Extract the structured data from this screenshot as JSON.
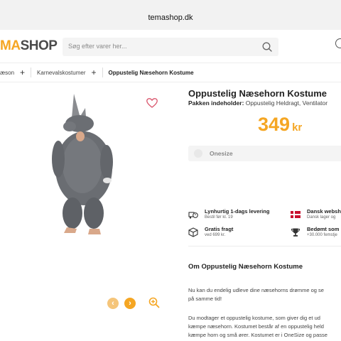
{
  "browser": {
    "url": "temashop.dk"
  },
  "header": {
    "logo_part1": "MA",
    "logo_part2": "SHOP",
    "search_placeholder": "Søg efter varer her...",
    "brand_color": "#f5a623"
  },
  "breadcrumb": [
    {
      "label": "æson"
    },
    {
      "label": "Karnevalskostumer"
    },
    {
      "label": "Oppustelig Næsehorn Kostume"
    }
  ],
  "gallery": {
    "prev_icon": "chevron-left-icon",
    "next_icon": "chevron-right-icon",
    "zoom_icon": "zoom-in-icon"
  },
  "product": {
    "title": "Oppustelig Næsehorn Kostume",
    "contents_label": "Pakken indeholder:",
    "contents_value": "Oppustelig Heldragt, Ventilator",
    "price": "349",
    "currency": "kr",
    "size_option": "Onesize"
  },
  "usps": [
    {
      "title": "Lynhurtig 1-dags levering",
      "sub": "Bestil før kl. 19",
      "icon": "truck-clock-icon"
    },
    {
      "title": "Dansk websh",
      "sub": "Dansk lager og",
      "icon": "danish-flag-icon"
    },
    {
      "title": "Gratis fragt",
      "sub": "ved 699 kr.",
      "icon": "package-icon"
    },
    {
      "title": "Bedømt som",
      "sub": "+30.000 femstje",
      "icon": "trophy-icon"
    }
  ],
  "about": {
    "title": "Om Oppustelig Næsehorn Kostume",
    "p1_line1": "Nu kan du endelig udleve dine næsehorns drømme og se",
    "p1_line2": "på samme tid!",
    "p2_line1": "Du modtager et oppustelig kostume, som giver dig et ud",
    "p2_line2": "kæmpe næsehorn. Kostumet består af en oppustelig held",
    "p2_line3": "kæmpe horn og små ører. Kostumet er i OneSize og passe"
  }
}
